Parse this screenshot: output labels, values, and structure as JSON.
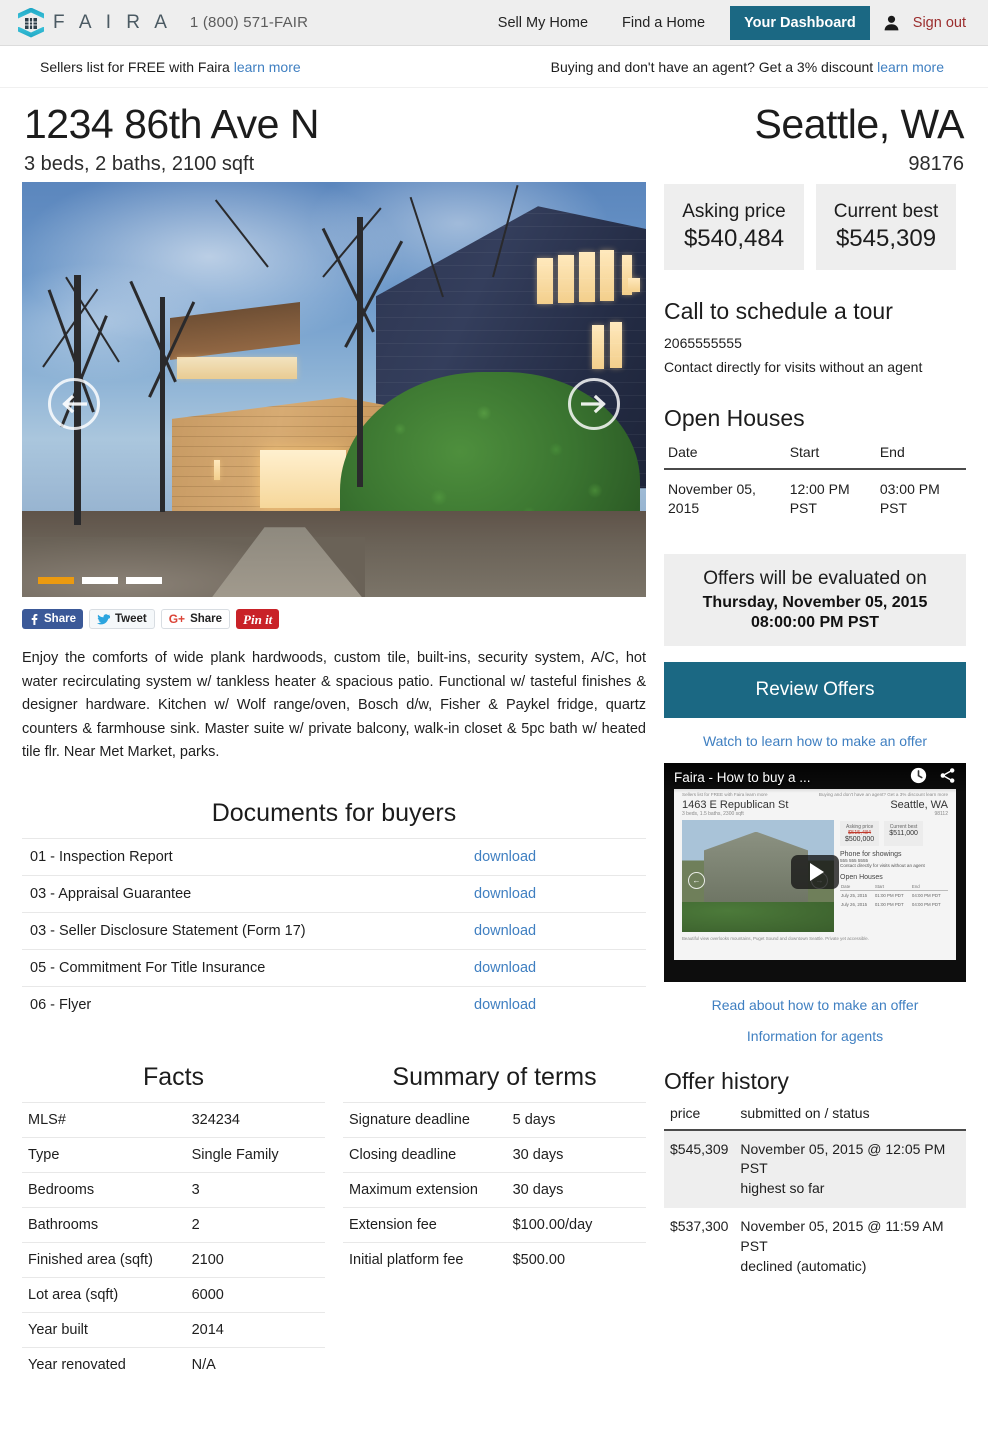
{
  "header": {
    "brand_name": "F A I R A",
    "phone": "1 (800) 571-FAIR",
    "nav": [
      {
        "label": "Sell My Home"
      },
      {
        "label": "Find a Home"
      }
    ],
    "dashboard_label": "Your Dashboard",
    "signout_label": "Sign out"
  },
  "promo": {
    "left_text": "Sellers list for FREE with Faira",
    "left_link": "learn more",
    "right_text": "Buying and don't have an agent? Get a 3% discount",
    "right_link": "learn more"
  },
  "listing": {
    "address": "1234 86th Ave N",
    "summary": "3 beds, 2 baths, 2100 sqft",
    "city_state": "Seattle, WA",
    "zip": "98176",
    "description": "Enjoy the comforts of wide plank hardwoods, custom tile, built-ins, security system, A/C, hot water recirculating system w/ tankless heater & spacious patio. Functional w/ tasteful finishes & designer hardware. Kitchen w/ Wolf range/oven, Bosch d/w, Fisher & Paykel fridge, quartz counters & farmhouse sink. Master suite w/ private balcony, walk-in closet & 5pc bath w/ heated tile flr. Near Met Market, parks."
  },
  "carousel": {
    "prev_label": "Previous photo",
    "next_label": "Next photo",
    "slide_count": 3,
    "active_slide": 1,
    "active_bar_color": "#eb9a10"
  },
  "social": {
    "facebook": "Share",
    "twitter": "Tweet",
    "googleplus": "Share",
    "pinterest": "Pin it"
  },
  "documents": {
    "title": "Documents for buyers",
    "download_label": "download",
    "items": [
      {
        "name": "01 - Inspection Report"
      },
      {
        "name": "03 - Appraisal Guarantee"
      },
      {
        "name": "03 - Seller Disclosure Statement (Form 17)"
      },
      {
        "name": "05 - Commitment For Title Insurance"
      },
      {
        "name": "06 - Flyer"
      }
    ]
  },
  "facts": {
    "title": "Facts",
    "rows": [
      {
        "k": "MLS#",
        "v": "324234"
      },
      {
        "k": "Type",
        "v": "Single Family"
      },
      {
        "k": "Bedrooms",
        "v": "3"
      },
      {
        "k": "Bathrooms",
        "v": "2"
      },
      {
        "k": "Finished area (sqft)",
        "v": "2100"
      },
      {
        "k": "Lot area (sqft)",
        "v": "6000"
      },
      {
        "k": "Year built",
        "v": "2014"
      },
      {
        "k": "Year renovated",
        "v": "N/A"
      }
    ]
  },
  "terms": {
    "title": "Summary of terms",
    "rows": [
      {
        "k": "Signature deadline",
        "v": "5 days"
      },
      {
        "k": "Closing deadline",
        "v": "30 days"
      },
      {
        "k": "Maximum extension",
        "v": "30 days"
      },
      {
        "k": "Extension fee",
        "v": "$100.00/day"
      },
      {
        "k": "Initial platform fee",
        "v": "$500.00"
      }
    ]
  },
  "sidebar": {
    "asking_label": "Asking price",
    "asking_value": "$540,484",
    "best_label": "Current best",
    "best_value": "$545,309",
    "tour_heading": "Call to schedule a tour",
    "tour_phone": "2065555555",
    "tour_note": "Contact directly for visits without an agent",
    "open_houses_heading": "Open Houses",
    "open_houses_columns": {
      "date": "Date",
      "start": "Start",
      "end": "End"
    },
    "open_houses": [
      {
        "date": "November 05, 2015",
        "start": "12:00 PM PST",
        "end": "03:00 PM PST"
      }
    ],
    "eval_line1": "Offers will be evaluated on",
    "eval_line2": "Thursday, November 05, 2015",
    "eval_line3": "08:00:00 PM PST",
    "review_offers_label": "Review Offers",
    "watch_link": "Watch to learn how to make an offer",
    "read_link": "Read about how to make an offer",
    "agents_link": "Information for agents",
    "accent_color": "#1b6883"
  },
  "video": {
    "title": "Faira - How to buy a ...",
    "watch_later_icon": "clock-icon",
    "share_icon": "share-icon",
    "play_label": "Play",
    "thumb": {
      "promo_left": "Sellers list for FREE with Faira learn more",
      "promo_right": "Buying and don't have an agent? Get a 3% discount learn more",
      "address": "1463 E Republican St",
      "summary": "3 beds, 1.5 baths, 2300 sqft",
      "city_state": "Seattle, WA",
      "zip": "98112",
      "asking_label": "Asking price",
      "asking_old": "$515,484",
      "asking_value": "$500,000",
      "best_label": "Current best",
      "best_value": "$511,000",
      "phone_heading": "Phone for showings",
      "phone_value": "555 555 5555",
      "phone_note": "Contact directly for visits without an agent",
      "open_heading": "Open Houses",
      "cols": {
        "date": "Date",
        "start": "Start",
        "end": "End"
      },
      "rows": [
        {
          "date": "July 25, 2015",
          "start": "01:00 PM PDT",
          "end": "04:00 PM PDT"
        },
        {
          "date": "July 26, 2015",
          "start": "01:00 PM PDT",
          "end": "04:00 PM PDT"
        }
      ],
      "footer": "Beautiful view overlooks mountains, Puget Sound and downtown Seattle. Private yet accessible."
    }
  },
  "offer_history": {
    "heading": "Offer history",
    "columns": {
      "price": "price",
      "status": "submitted on / status"
    },
    "rows": [
      {
        "price": "$545,309",
        "when": "November 05, 2015 @ 12:05 PM PST",
        "status": "highest so far",
        "highlight": true
      },
      {
        "price": "$537,300",
        "when": "November 05, 2015 @ 11:59 AM PST",
        "status": "declined (automatic)",
        "highlight": false
      }
    ]
  }
}
